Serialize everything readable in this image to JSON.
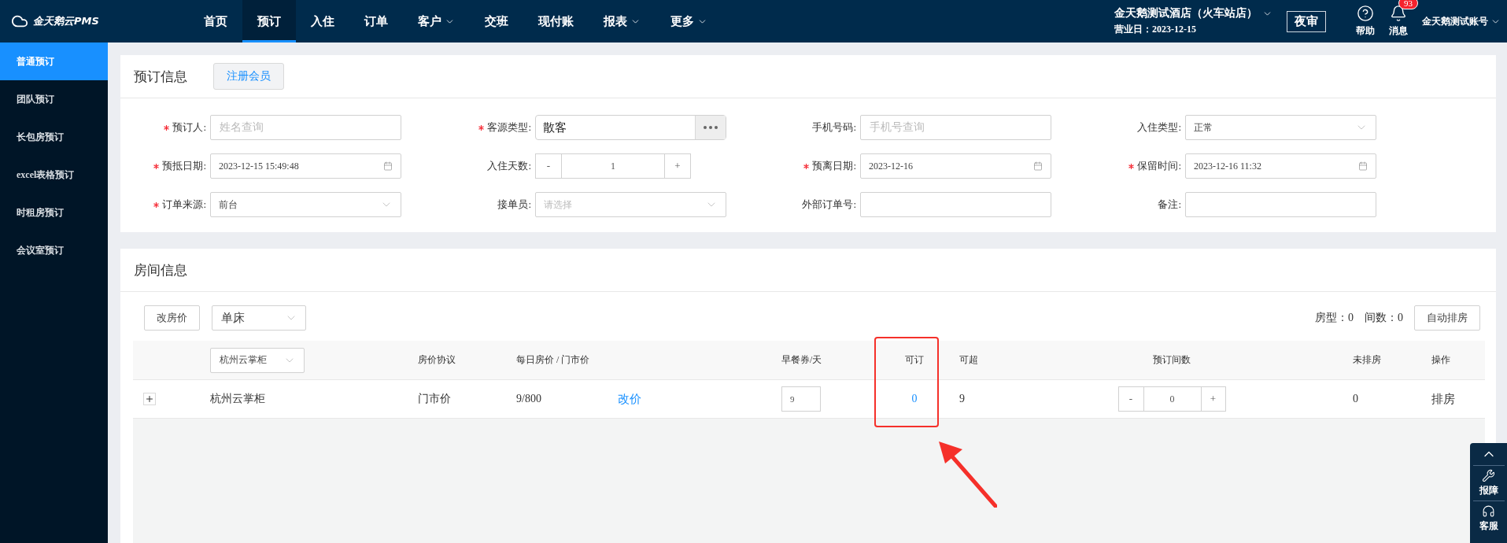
{
  "header": {
    "logo": "金天鹅云PMS",
    "nav": [
      {
        "label": "首页",
        "selected": false,
        "dropdown": false
      },
      {
        "label": "预订",
        "selected": true,
        "dropdown": false
      },
      {
        "label": "入住",
        "selected": false,
        "dropdown": false
      },
      {
        "label": "订单",
        "selected": false,
        "dropdown": false
      },
      {
        "label": "客户",
        "selected": false,
        "dropdown": true
      },
      {
        "label": "交班",
        "selected": false,
        "dropdown": false
      },
      {
        "label": "现付账",
        "selected": false,
        "dropdown": false
      },
      {
        "label": "报表",
        "selected": false,
        "dropdown": true
      },
      {
        "label": "更多",
        "selected": false,
        "dropdown": true
      }
    ],
    "hotel": {
      "name": "金天鹅测试酒店（火车站店）",
      "business_day": "营业日：2023-12-15"
    },
    "night_audit": "夜审",
    "help": "帮助",
    "messages": {
      "label": "消息",
      "badge": "93"
    },
    "account": "金天鹅测试账号"
  },
  "sidebar": {
    "items": [
      {
        "label": "普通预订",
        "selected": true
      },
      {
        "label": "团队预订",
        "selected": false
      },
      {
        "label": "长包房预订",
        "selected": false
      },
      {
        "label": "excel表格预订",
        "selected": false
      },
      {
        "label": "时租房预订",
        "selected": false
      },
      {
        "label": "会议室预订",
        "selected": false
      }
    ]
  },
  "booking": {
    "title": "预订信息",
    "register_button": "注册会员",
    "fields": [
      {
        "label": "预订人:",
        "required": true,
        "kind": "text",
        "placeholder": "姓名查询"
      },
      {
        "label": "客源类型:",
        "required": true,
        "kind": "picker",
        "value": "散客"
      },
      {
        "label": "手机号码:",
        "required": false,
        "kind": "text",
        "placeholder": "手机号查询"
      },
      {
        "label": "入住类型:",
        "required": false,
        "kind": "select",
        "value": "正常"
      },
      {
        "label": "预抵日期:",
        "required": true,
        "kind": "date",
        "value": "2023-12-15 15:49:48"
      },
      {
        "label": "入住天数:",
        "required": false,
        "kind": "stepper",
        "value": "1",
        "minus": "-",
        "plus": "+"
      },
      {
        "label": "预离日期:",
        "required": true,
        "kind": "date",
        "value": "2023-12-16"
      },
      {
        "label": "保留时间:",
        "required": true,
        "kind": "date",
        "value": "2023-12-16 11:32"
      },
      {
        "label": "订单来源:",
        "required": true,
        "kind": "select",
        "value": "前台"
      },
      {
        "label": "接单员:",
        "required": false,
        "kind": "select",
        "placeholder": "请选择"
      },
      {
        "label": "外部订单号:",
        "required": false,
        "kind": "text"
      },
      {
        "label": "备注:",
        "required": false,
        "kind": "text"
      }
    ]
  },
  "rooms": {
    "title": "房间信息",
    "change_price_button": "改房价",
    "bed_select": "单床",
    "summary": [
      {
        "label": "房型：",
        "value": "0"
      },
      {
        "label": "间数：",
        "value": "0"
      }
    ],
    "auto_assign_button": "自动排房",
    "type_filter": "杭州云掌柜",
    "columns": [
      "房价协议",
      "每日房价 / 门市价",
      "早餐券/天",
      "可订",
      "可超",
      "预订间数",
      "未排房",
      "操作"
    ],
    "rows": [
      {
        "expanded": false,
        "room_type": "杭州云掌柜",
        "agreement": "门市价",
        "price": "9/800",
        "change_price": "改价",
        "breakfast": "9",
        "available": "0",
        "oversell": "9",
        "count": {
          "value": "0",
          "minus": "-",
          "plus": "+"
        },
        "unassigned": "0",
        "action": "排房"
      }
    ]
  },
  "float_panel": {
    "items": [
      "报障",
      "客服"
    ]
  }
}
